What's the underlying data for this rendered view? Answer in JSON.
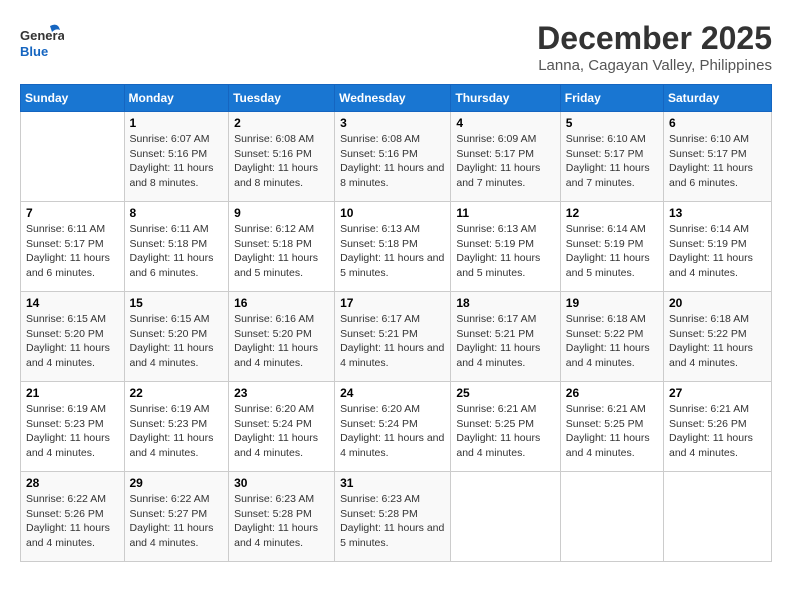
{
  "header": {
    "logo_line1": "General",
    "logo_line2": "Blue",
    "month": "December 2025",
    "location": "Lanna, Cagayan Valley, Philippines"
  },
  "weekdays": [
    "Sunday",
    "Monday",
    "Tuesday",
    "Wednesday",
    "Thursday",
    "Friday",
    "Saturday"
  ],
  "weeks": [
    [
      {
        "day": "",
        "info": ""
      },
      {
        "day": "1",
        "info": "Sunrise: 6:07 AM\nSunset: 5:16 PM\nDaylight: 11 hours and 8 minutes."
      },
      {
        "day": "2",
        "info": "Sunrise: 6:08 AM\nSunset: 5:16 PM\nDaylight: 11 hours and 8 minutes."
      },
      {
        "day": "3",
        "info": "Sunrise: 6:08 AM\nSunset: 5:16 PM\nDaylight: 11 hours and 8 minutes."
      },
      {
        "day": "4",
        "info": "Sunrise: 6:09 AM\nSunset: 5:17 PM\nDaylight: 11 hours and 7 minutes."
      },
      {
        "day": "5",
        "info": "Sunrise: 6:10 AM\nSunset: 5:17 PM\nDaylight: 11 hours and 7 minutes."
      },
      {
        "day": "6",
        "info": "Sunrise: 6:10 AM\nSunset: 5:17 PM\nDaylight: 11 hours and 6 minutes."
      }
    ],
    [
      {
        "day": "7",
        "info": "Sunrise: 6:11 AM\nSunset: 5:17 PM\nDaylight: 11 hours and 6 minutes."
      },
      {
        "day": "8",
        "info": "Sunrise: 6:11 AM\nSunset: 5:18 PM\nDaylight: 11 hours and 6 minutes."
      },
      {
        "day": "9",
        "info": "Sunrise: 6:12 AM\nSunset: 5:18 PM\nDaylight: 11 hours and 5 minutes."
      },
      {
        "day": "10",
        "info": "Sunrise: 6:13 AM\nSunset: 5:18 PM\nDaylight: 11 hours and 5 minutes."
      },
      {
        "day": "11",
        "info": "Sunrise: 6:13 AM\nSunset: 5:19 PM\nDaylight: 11 hours and 5 minutes."
      },
      {
        "day": "12",
        "info": "Sunrise: 6:14 AM\nSunset: 5:19 PM\nDaylight: 11 hours and 5 minutes."
      },
      {
        "day": "13",
        "info": "Sunrise: 6:14 AM\nSunset: 5:19 PM\nDaylight: 11 hours and 4 minutes."
      }
    ],
    [
      {
        "day": "14",
        "info": "Sunrise: 6:15 AM\nSunset: 5:20 PM\nDaylight: 11 hours and 4 minutes."
      },
      {
        "day": "15",
        "info": "Sunrise: 6:15 AM\nSunset: 5:20 PM\nDaylight: 11 hours and 4 minutes."
      },
      {
        "day": "16",
        "info": "Sunrise: 6:16 AM\nSunset: 5:20 PM\nDaylight: 11 hours and 4 minutes."
      },
      {
        "day": "17",
        "info": "Sunrise: 6:17 AM\nSunset: 5:21 PM\nDaylight: 11 hours and 4 minutes."
      },
      {
        "day": "18",
        "info": "Sunrise: 6:17 AM\nSunset: 5:21 PM\nDaylight: 11 hours and 4 minutes."
      },
      {
        "day": "19",
        "info": "Sunrise: 6:18 AM\nSunset: 5:22 PM\nDaylight: 11 hours and 4 minutes."
      },
      {
        "day": "20",
        "info": "Sunrise: 6:18 AM\nSunset: 5:22 PM\nDaylight: 11 hours and 4 minutes."
      }
    ],
    [
      {
        "day": "21",
        "info": "Sunrise: 6:19 AM\nSunset: 5:23 PM\nDaylight: 11 hours and 4 minutes."
      },
      {
        "day": "22",
        "info": "Sunrise: 6:19 AM\nSunset: 5:23 PM\nDaylight: 11 hours and 4 minutes."
      },
      {
        "day": "23",
        "info": "Sunrise: 6:20 AM\nSunset: 5:24 PM\nDaylight: 11 hours and 4 minutes."
      },
      {
        "day": "24",
        "info": "Sunrise: 6:20 AM\nSunset: 5:24 PM\nDaylight: 11 hours and 4 minutes."
      },
      {
        "day": "25",
        "info": "Sunrise: 6:21 AM\nSunset: 5:25 PM\nDaylight: 11 hours and 4 minutes."
      },
      {
        "day": "26",
        "info": "Sunrise: 6:21 AM\nSunset: 5:25 PM\nDaylight: 11 hours and 4 minutes."
      },
      {
        "day": "27",
        "info": "Sunrise: 6:21 AM\nSunset: 5:26 PM\nDaylight: 11 hours and 4 minutes."
      }
    ],
    [
      {
        "day": "28",
        "info": "Sunrise: 6:22 AM\nSunset: 5:26 PM\nDaylight: 11 hours and 4 minutes."
      },
      {
        "day": "29",
        "info": "Sunrise: 6:22 AM\nSunset: 5:27 PM\nDaylight: 11 hours and 4 minutes."
      },
      {
        "day": "30",
        "info": "Sunrise: 6:23 AM\nSunset: 5:28 PM\nDaylight: 11 hours and 4 minutes."
      },
      {
        "day": "31",
        "info": "Sunrise: 6:23 AM\nSunset: 5:28 PM\nDaylight: 11 hours and 5 minutes."
      },
      {
        "day": "",
        "info": ""
      },
      {
        "day": "",
        "info": ""
      },
      {
        "day": "",
        "info": ""
      }
    ]
  ]
}
